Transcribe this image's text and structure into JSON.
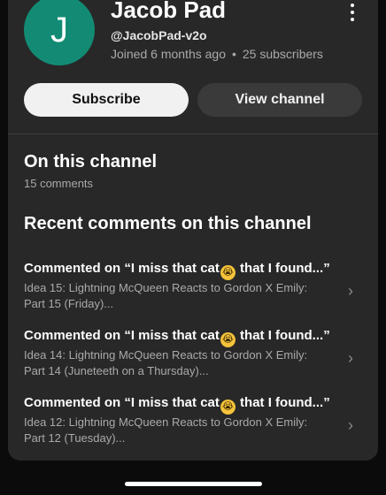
{
  "channel": {
    "avatar_letter": "J",
    "avatar_color": "#138b74",
    "name": "Jacob Pad",
    "handle": "@JacobPad-v2o",
    "joined": "Joined 6 months ago",
    "separator": "•",
    "subscribers": "25 subscribers"
  },
  "actions": {
    "subscribe_label": "Subscribe",
    "view_channel_label": "View channel"
  },
  "on_channel": {
    "heading": "On this channel",
    "count": "15 comments"
  },
  "recent": {
    "heading": "Recent comments on this channel",
    "items": [
      {
        "prefix": "Commented on “I miss that cat",
        "emoji": "😭",
        "suffix": " that I found...”",
        "desc": "Idea 15: Lightning McQueen Reacts to Gordon X Emily: Part 15 (Friday)..."
      },
      {
        "prefix": "Commented on “I miss that cat",
        "emoji": "😭",
        "suffix": " that I found...”",
        "desc": "Idea 14: Lightning McQueen Reacts to Gordon X Emily: Part 14 (Juneteeth on a Thursday)..."
      },
      {
        "prefix": "Commented on “I miss that cat",
        "emoji": "😭",
        "suffix": " that I found...”",
        "desc": "Idea 12: Lightning McQueen Reacts to Gordon X Emily: Part 12 (Tuesday)..."
      }
    ]
  },
  "icons": {
    "menu": "more-vert-icon",
    "chevron": "chevron-right-icon"
  },
  "colors": {
    "sheet_bg": "#282828",
    "page_bg": "#0b0b0b",
    "subscribe_bg": "#f1f1f1",
    "view_channel_bg": "#3a3a3a"
  }
}
